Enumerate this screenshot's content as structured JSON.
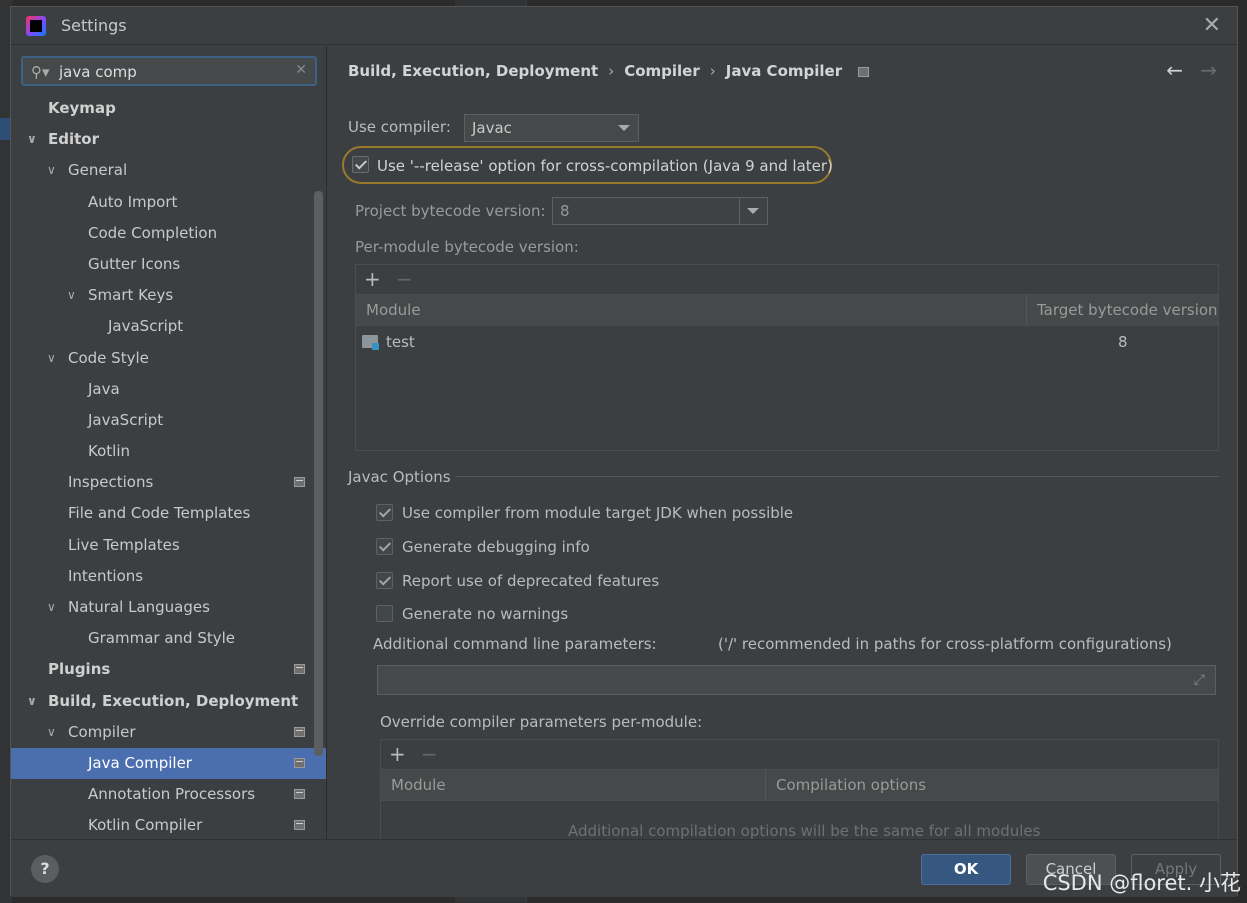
{
  "window": {
    "title": "Settings"
  },
  "search": {
    "value": "java comp",
    "placeholder": ""
  },
  "tree": [
    {
      "label": "Keymap",
      "bold": true,
      "level": 0,
      "expand": "",
      "page_icon": false
    },
    {
      "label": "Editor",
      "bold": true,
      "level": 0,
      "expand": "open",
      "page_icon": false
    },
    {
      "label": "General",
      "bold": false,
      "level": 1,
      "expand": "open",
      "page_icon": false
    },
    {
      "label": "Auto Import",
      "bold": false,
      "level": 2,
      "expand": "",
      "page_icon": false
    },
    {
      "label": "Code Completion",
      "bold": false,
      "level": 2,
      "expand": "",
      "page_icon": false
    },
    {
      "label": "Gutter Icons",
      "bold": false,
      "level": 2,
      "expand": "",
      "page_icon": false
    },
    {
      "label": "Smart Keys",
      "bold": false,
      "level": 2,
      "expand": "open",
      "page_icon": false
    },
    {
      "label": "JavaScript",
      "bold": false,
      "level": 3,
      "expand": "",
      "page_icon": false
    },
    {
      "label": "Code Style",
      "bold": false,
      "level": 1,
      "expand": "open",
      "page_icon": false
    },
    {
      "label": "Java",
      "bold": false,
      "level": 2,
      "expand": "",
      "page_icon": false
    },
    {
      "label": "JavaScript",
      "bold": false,
      "level": 2,
      "expand": "",
      "page_icon": false
    },
    {
      "label": "Kotlin",
      "bold": false,
      "level": 2,
      "expand": "",
      "page_icon": false
    },
    {
      "label": "Inspections",
      "bold": false,
      "level": 1,
      "expand": "",
      "page_icon": true
    },
    {
      "label": "File and Code Templates",
      "bold": false,
      "level": 1,
      "expand": "",
      "page_icon": false
    },
    {
      "label": "Live Templates",
      "bold": false,
      "level": 1,
      "expand": "",
      "page_icon": false
    },
    {
      "label": "Intentions",
      "bold": false,
      "level": 1,
      "expand": "",
      "page_icon": false
    },
    {
      "label": "Natural Languages",
      "bold": false,
      "level": 1,
      "expand": "open",
      "page_icon": false
    },
    {
      "label": "Grammar and Style",
      "bold": false,
      "level": 2,
      "expand": "",
      "page_icon": false
    },
    {
      "label": "Plugins",
      "bold": true,
      "level": 0,
      "expand": "",
      "page_icon": true
    },
    {
      "label": "Build, Execution, Deployment",
      "bold": true,
      "level": 0,
      "expand": "open",
      "page_icon": false
    },
    {
      "label": "Compiler",
      "bold": false,
      "level": 1,
      "expand": "open",
      "page_icon": true
    },
    {
      "label": "Java Compiler",
      "bold": false,
      "level": 2,
      "expand": "",
      "page_icon": true,
      "selected": true
    },
    {
      "label": "Annotation Processors",
      "bold": false,
      "level": 2,
      "expand": "",
      "page_icon": true
    },
    {
      "label": "Kotlin Compiler",
      "bold": false,
      "level": 2,
      "expand": "",
      "page_icon": true
    }
  ],
  "breadcrumb": [
    "Build, Execution, Deployment",
    "Compiler",
    "Java Compiler"
  ],
  "compiler": {
    "use_compiler_label": "Use compiler:",
    "use_compiler_value": "Javac",
    "release_option_label": "Use '--release' option for cross-compilation (Java 9 and later)",
    "release_option_checked": true,
    "bytecode_label": "Project bytecode version:",
    "bytecode_value": "8",
    "per_module_label": "Per-module bytecode version:",
    "module_table": {
      "columns": [
        "Module",
        "Target bytecode version"
      ],
      "rows": [
        {
          "module": "test",
          "version": "8"
        }
      ]
    }
  },
  "javac": {
    "section_title": "Javac Options",
    "options": [
      {
        "label": "Use compiler from module target JDK when possible",
        "checked": true
      },
      {
        "label": "Generate debugging info",
        "checked": true
      },
      {
        "label": "Report use of deprecated features",
        "checked": true
      },
      {
        "label": "Generate no warnings",
        "checked": false
      }
    ],
    "additional_params_label": "Additional command line parameters:",
    "additional_params_hint": "('/' recommended in paths for cross-platform configurations)",
    "additional_params_value": "",
    "override_label": "Override compiler parameters per-module:",
    "override_table": {
      "columns": [
        "Module",
        "Compilation options"
      ],
      "empty_text": "Additional compilation options will be the same for all modules"
    }
  },
  "buttons": {
    "help": "?",
    "ok": "OK",
    "cancel": "Cancel",
    "apply": "Apply"
  },
  "watermark": "CSDN @floret. 小花",
  "colors": {
    "selection": "#4b6eaf",
    "highlight_ring": "#9a7a2c",
    "ok_button": "#365880"
  }
}
